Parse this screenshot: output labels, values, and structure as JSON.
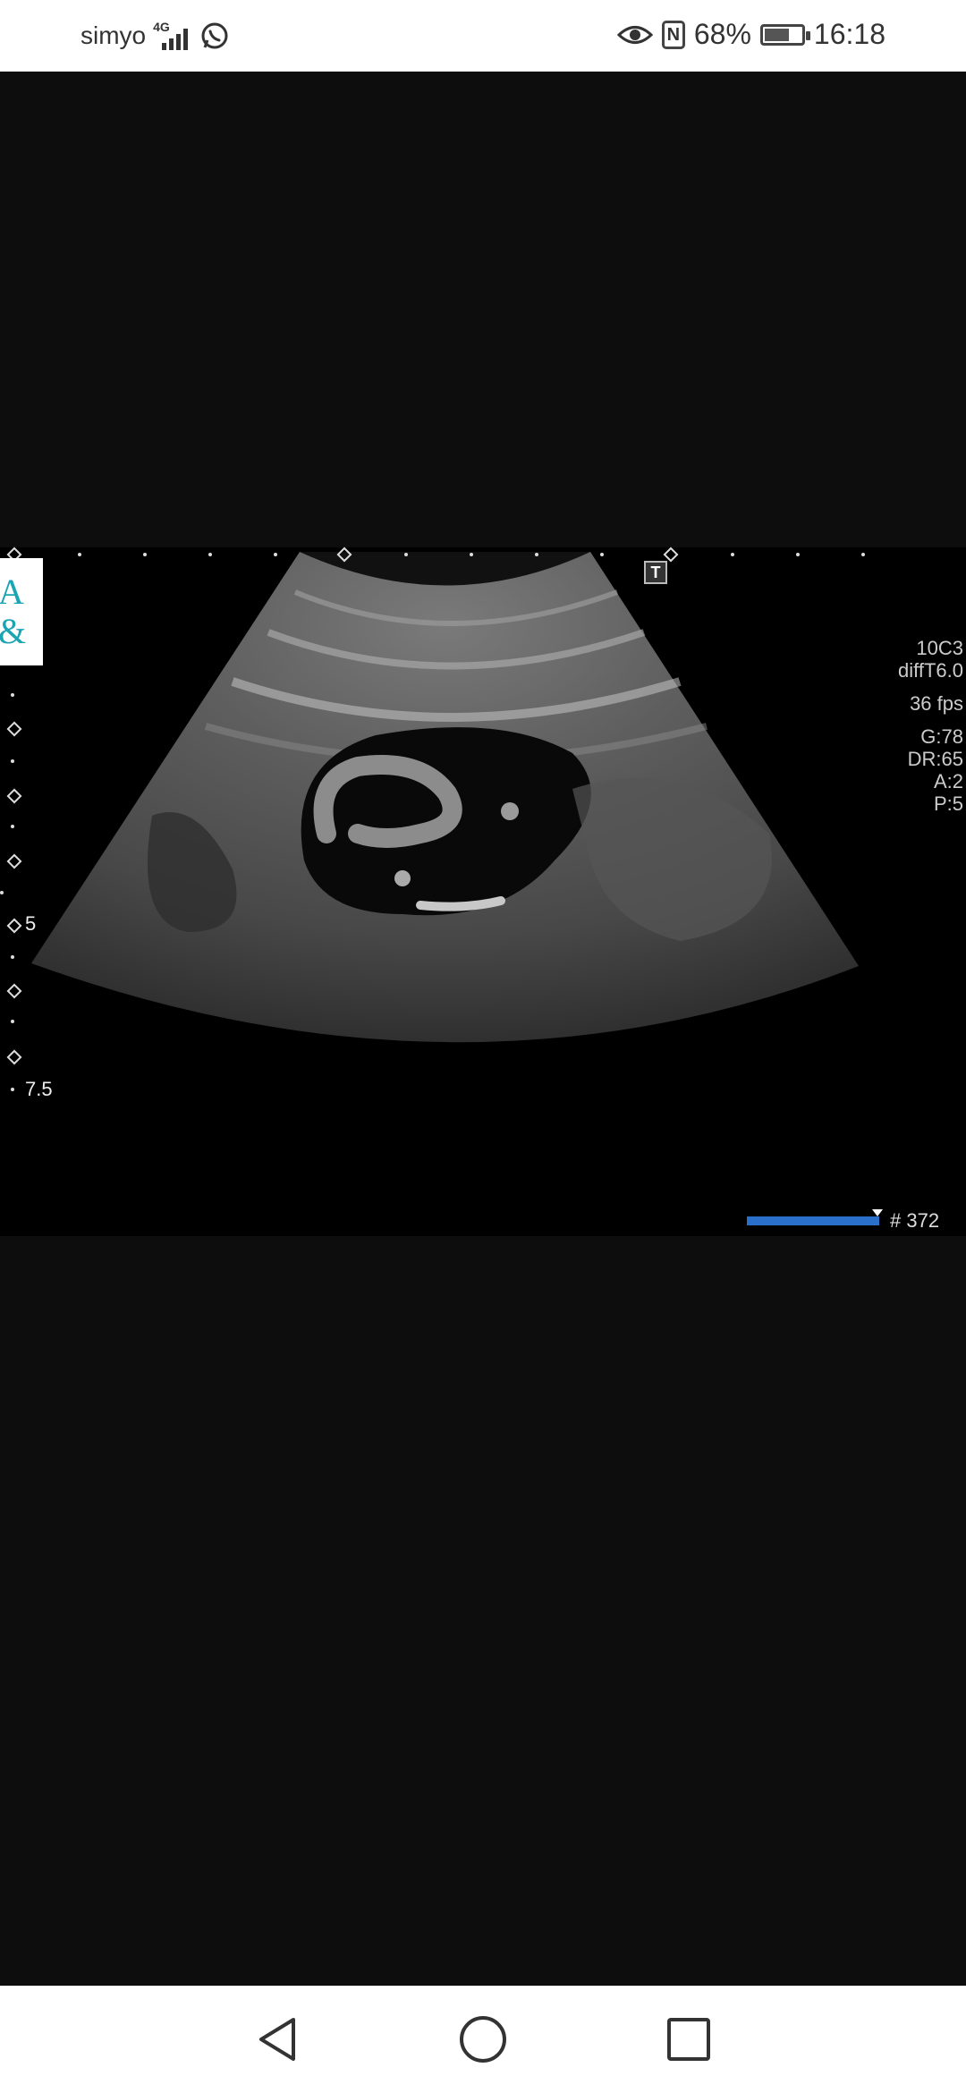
{
  "status_bar": {
    "carrier": "simyo",
    "network_type": "4G",
    "battery_percent": "68%",
    "battery_level": 0.68,
    "time": "16:18",
    "icons": [
      "signal-icon",
      "whatsapp-icon",
      "eye-icon",
      "nfc-icon",
      "battery-icon"
    ]
  },
  "ultrasound": {
    "logo_text": "A\n&",
    "depth_labels": {
      "mid": "5",
      "bottom": "7.5"
    },
    "probe": "10C3",
    "mode": "diffT6.0",
    "frame_rate": "36 fps",
    "params": [
      "G:78",
      "DR:65",
      "A:2",
      "P:5"
    ],
    "marker": "T",
    "frame_label": "# 372"
  },
  "nav_bar": {
    "buttons": [
      "back-button",
      "home-button",
      "recents-button"
    ]
  }
}
